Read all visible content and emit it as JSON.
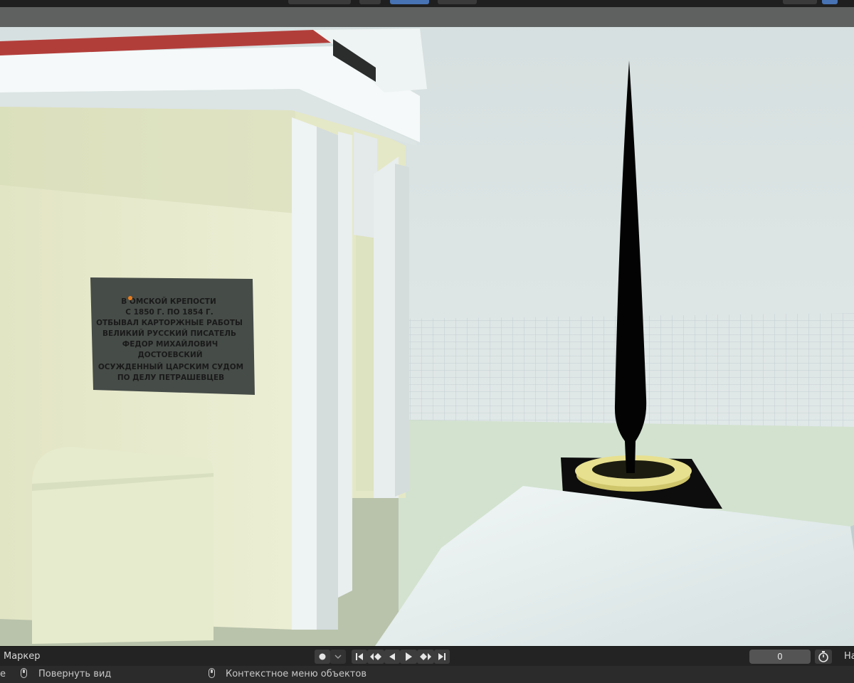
{
  "timeline": {
    "marker_label": "Маркер",
    "current_frame": "0",
    "truncated_label": "На"
  },
  "statusbar": {
    "left_fragment": "е",
    "rotate_view": "Повернуть вид",
    "context_menu": "Контекстное меню объектов"
  },
  "plaque": {
    "lines": [
      "В ОМСКОЙ КРЕПОСТИ",
      "С 1850 Г. ПО 1854 Г.",
      "ОТБЫВАЛ КАРТОРЖНЫЕ РАБОТЫ",
      "ВЕЛИКИЙ РУССКИЙ ПИСАТЕЛЬ",
      "ФЕДОР МИХАЙЛОВИЧ",
      "ДОСТОЕВСКИЙ",
      "ОСУЖДЕННЫЙ ЦАРСКИМ СУДОМ",
      "ПО ДЕЛУ ПЕТРАШЕВЦЕВ"
    ]
  },
  "icons": {
    "record": "record-icon",
    "jump_start": "jump-start-icon",
    "prev_keyframe": "prev-keyframe-icon",
    "play_reverse": "play-reverse-icon",
    "play": "play-icon",
    "next_keyframe": "next-keyframe-icon",
    "jump_end": "jump-end-icon",
    "stopwatch": "stopwatch-icon",
    "mouse_middle": "mouse-middle-icon",
    "mouse_right": "mouse-right-icon"
  },
  "colors": {
    "ui_dark": "#232323",
    "field": "#545454",
    "sky": "#dfe7e7",
    "wall": "#e9ebcc",
    "plaque": "#464c48",
    "ring": "#e7e08f"
  }
}
